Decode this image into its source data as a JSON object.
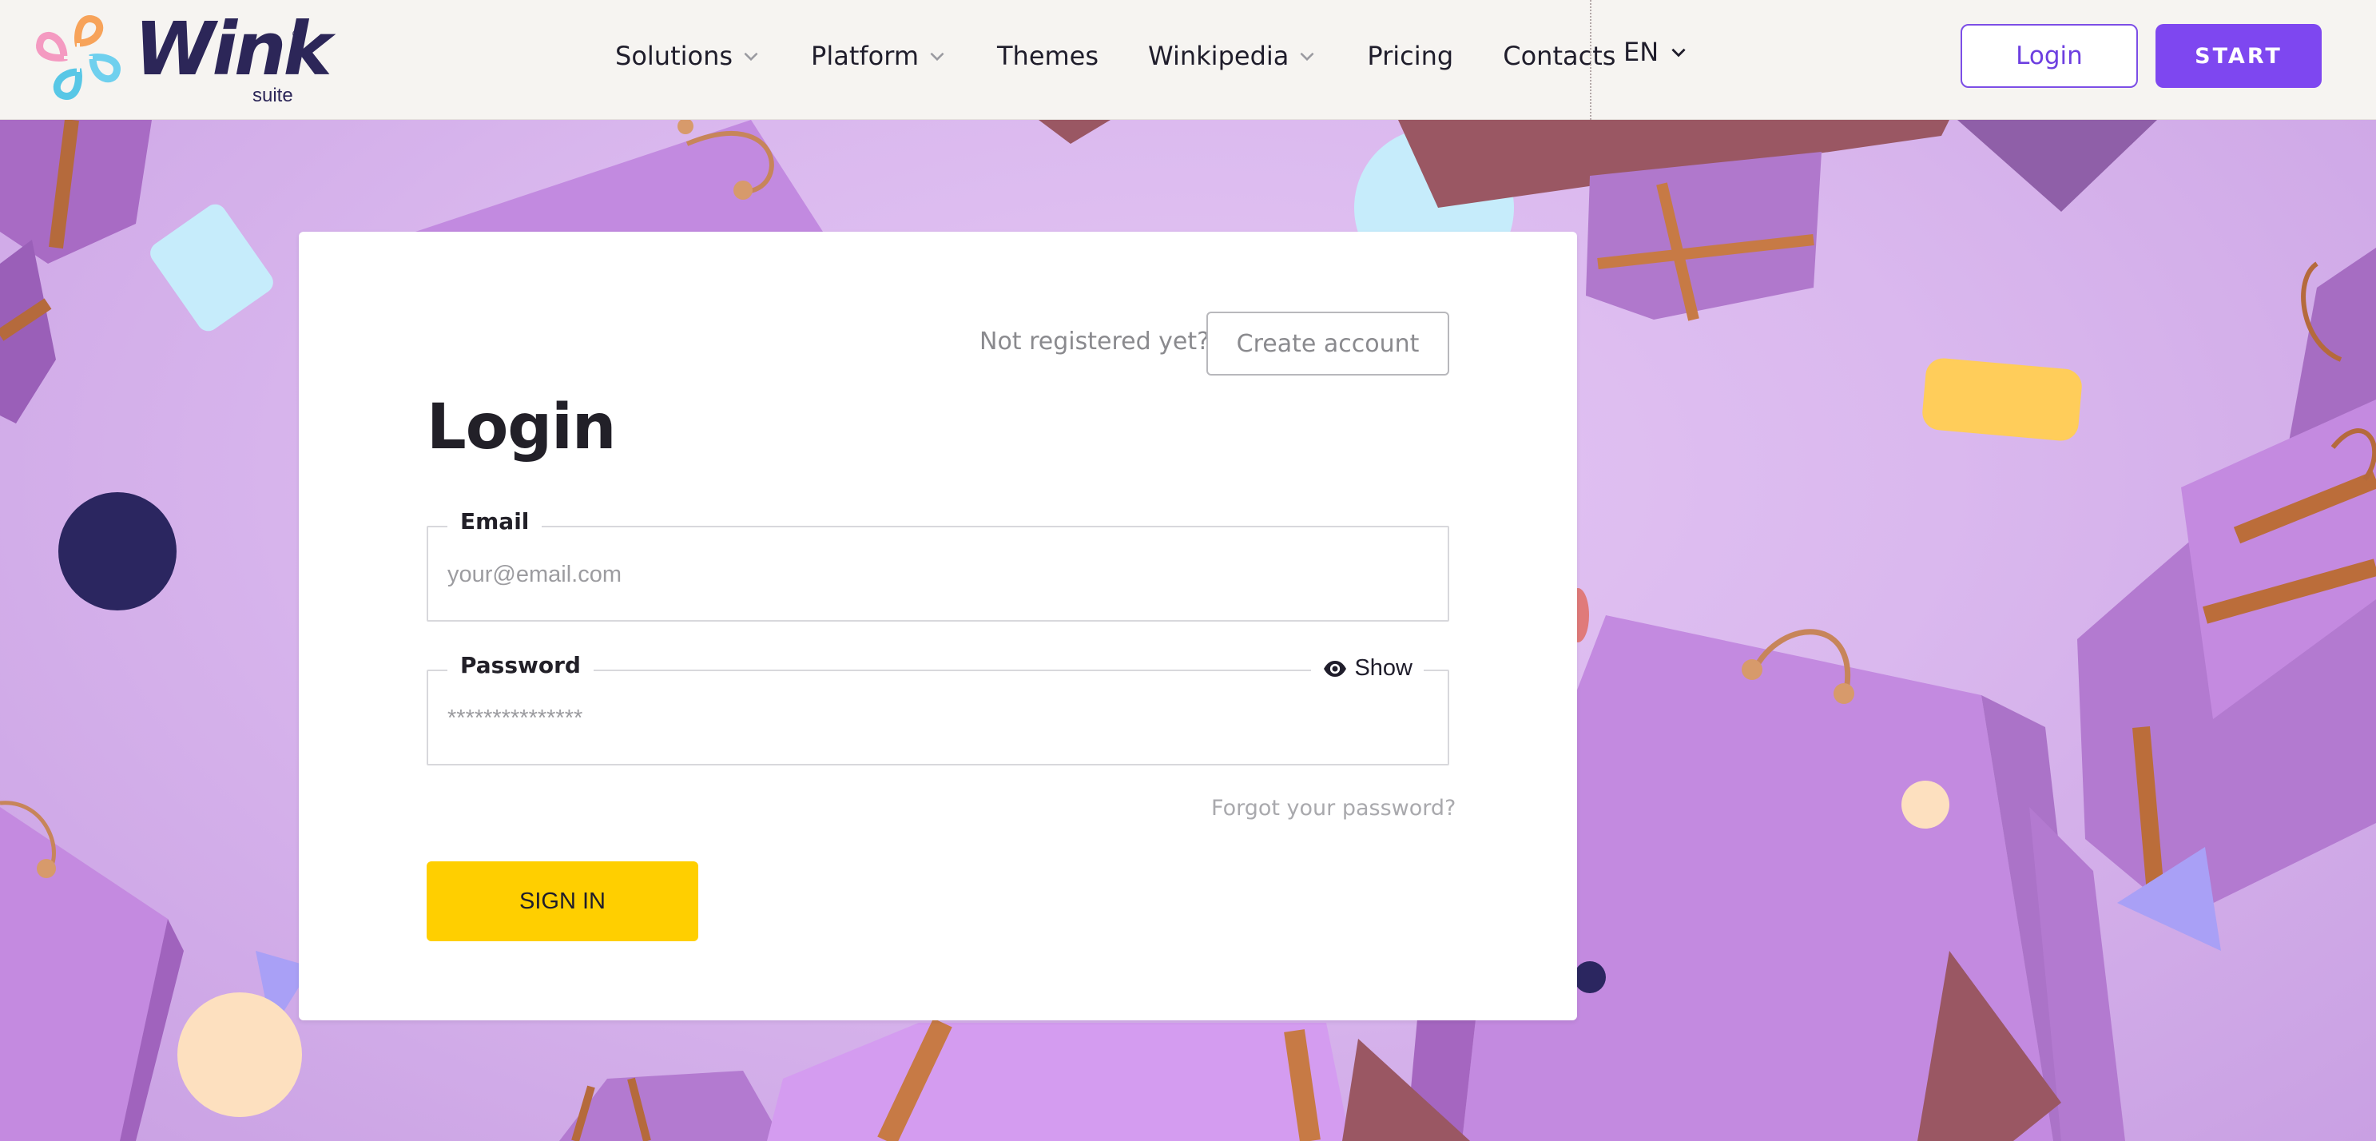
{
  "brand": {
    "name": "Wink",
    "sub": "suite",
    "reg": "®"
  },
  "nav": {
    "items": [
      {
        "label": "Solutions",
        "has_dropdown": true
      },
      {
        "label": "Platform",
        "has_dropdown": true
      },
      {
        "label": "Themes",
        "has_dropdown": false
      },
      {
        "label": "Winkipedia",
        "has_dropdown": true
      },
      {
        "label": "Pricing",
        "has_dropdown": false
      },
      {
        "label": "Contacts",
        "has_dropdown": false
      }
    ],
    "language": "EN",
    "login_label": "Login",
    "start_label": "START"
  },
  "login_card": {
    "not_registered": "Not registered yet?",
    "create_account": "Create account",
    "title": "Login",
    "email_label": "Email",
    "email_placeholder": "your@email.com",
    "password_label": "Password",
    "password_placeholder": "***************",
    "show_label": "Show",
    "forgot": "Forgot your password?",
    "sign_in": "SIGN IN"
  },
  "colors": {
    "accent": "#7e47f0",
    "sign_in": "#ffcf00",
    "header_bg": "#f6f4f1",
    "background": "#dab8ee"
  },
  "icons": {
    "chevron": "chevron-down-icon",
    "show": "eye-icon",
    "logo": "wink-logo-mark"
  }
}
